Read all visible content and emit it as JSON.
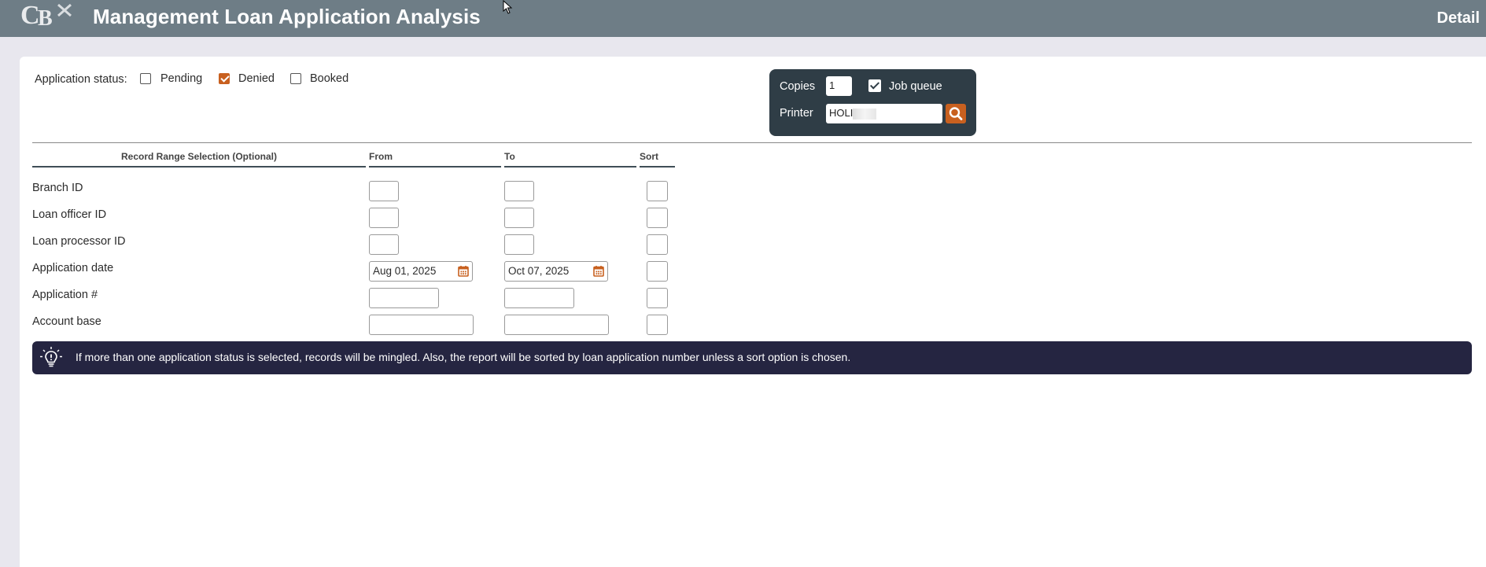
{
  "header": {
    "title": "Management Loan Application Analysis",
    "mode": "Detail",
    "logo_icon": "cbx-logo"
  },
  "status": {
    "label": "Application status:",
    "options": [
      {
        "label": "Pending",
        "checked": false
      },
      {
        "label": "Denied",
        "checked": true
      },
      {
        "label": "Booked",
        "checked": false
      }
    ]
  },
  "print": {
    "copies_label": "Copies",
    "copies_value": "1",
    "job_queue_label": "Job queue",
    "job_queue_checked": true,
    "printer_label": "Printer",
    "printer_value": "HOLI",
    "search_icon": "search-icon"
  },
  "range": {
    "headers": {
      "selection": "Record Range Selection (Optional)",
      "from": "From",
      "to": "To",
      "sort": "Sort"
    },
    "rows": [
      {
        "label": "Branch ID",
        "from": "",
        "to": "",
        "sort": ""
      },
      {
        "label": "Loan officer ID",
        "from": "",
        "to": "",
        "sort": ""
      },
      {
        "label": "Loan processor ID",
        "from": "",
        "to": "",
        "sort": ""
      },
      {
        "label": "Application date",
        "from": "Aug 01, 2025",
        "to": "Oct 07, 2025",
        "sort": ""
      },
      {
        "label": "Application #",
        "from": "",
        "to": "",
        "sort": ""
      },
      {
        "label": "Account base",
        "from": "",
        "to": "",
        "sort": ""
      }
    ]
  },
  "info": {
    "icon": "lightbulb-icon",
    "text": "If more than one application status is selected, records will be mingled. Also, the report will be sorted by loan application number unless a sort option is chosen."
  },
  "colors": {
    "header_bg": "#6e7d86",
    "accent": "#c8601f",
    "print_box_bg": "#2f3d46",
    "info_bg": "#252541"
  }
}
